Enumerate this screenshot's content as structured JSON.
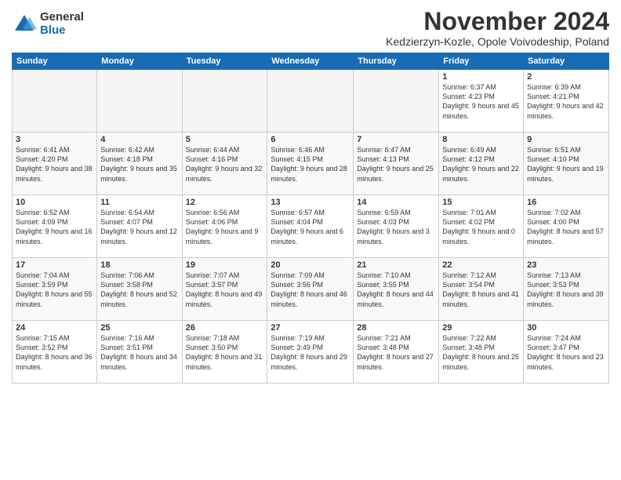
{
  "header": {
    "logo": {
      "general": "General",
      "blue": "Blue"
    },
    "title": "November 2024",
    "location": "Kedzierzyn-Kozle, Opole Voivodeship, Poland"
  },
  "weekdays": [
    "Sunday",
    "Monday",
    "Tuesday",
    "Wednesday",
    "Thursday",
    "Friday",
    "Saturday"
  ],
  "weeks": [
    [
      {
        "day": "",
        "empty": true
      },
      {
        "day": "",
        "empty": true
      },
      {
        "day": "",
        "empty": true
      },
      {
        "day": "",
        "empty": true
      },
      {
        "day": "",
        "empty": true
      },
      {
        "day": "1",
        "sunrise": "6:37 AM",
        "sunset": "4:23 PM",
        "daylight": "9 hours and 45 minutes."
      },
      {
        "day": "2",
        "sunrise": "6:39 AM",
        "sunset": "4:21 PM",
        "daylight": "9 hours and 42 minutes."
      }
    ],
    [
      {
        "day": "3",
        "sunrise": "6:41 AM",
        "sunset": "4:20 PM",
        "daylight": "9 hours and 38 minutes."
      },
      {
        "day": "4",
        "sunrise": "6:42 AM",
        "sunset": "4:18 PM",
        "daylight": "9 hours and 35 minutes."
      },
      {
        "day": "5",
        "sunrise": "6:44 AM",
        "sunset": "4:16 PM",
        "daylight": "9 hours and 32 minutes."
      },
      {
        "day": "6",
        "sunrise": "6:46 AM",
        "sunset": "4:15 PM",
        "daylight": "9 hours and 28 minutes."
      },
      {
        "day": "7",
        "sunrise": "6:47 AM",
        "sunset": "4:13 PM",
        "daylight": "9 hours and 25 minutes."
      },
      {
        "day": "8",
        "sunrise": "6:49 AM",
        "sunset": "4:12 PM",
        "daylight": "9 hours and 22 minutes."
      },
      {
        "day": "9",
        "sunrise": "6:51 AM",
        "sunset": "4:10 PM",
        "daylight": "9 hours and 19 minutes."
      }
    ],
    [
      {
        "day": "10",
        "sunrise": "6:52 AM",
        "sunset": "4:09 PM",
        "daylight": "9 hours and 16 minutes."
      },
      {
        "day": "11",
        "sunrise": "6:54 AM",
        "sunset": "4:07 PM",
        "daylight": "9 hours and 12 minutes."
      },
      {
        "day": "12",
        "sunrise": "6:56 AM",
        "sunset": "4:06 PM",
        "daylight": "9 hours and 9 minutes."
      },
      {
        "day": "13",
        "sunrise": "6:57 AM",
        "sunset": "4:04 PM",
        "daylight": "9 hours and 6 minutes."
      },
      {
        "day": "14",
        "sunrise": "6:59 AM",
        "sunset": "4:03 PM",
        "daylight": "9 hours and 3 minutes."
      },
      {
        "day": "15",
        "sunrise": "7:01 AM",
        "sunset": "4:02 PM",
        "daylight": "9 hours and 0 minutes."
      },
      {
        "day": "16",
        "sunrise": "7:02 AM",
        "sunset": "4:00 PM",
        "daylight": "8 hours and 57 minutes."
      }
    ],
    [
      {
        "day": "17",
        "sunrise": "7:04 AM",
        "sunset": "3:59 PM",
        "daylight": "8 hours and 55 minutes."
      },
      {
        "day": "18",
        "sunrise": "7:06 AM",
        "sunset": "3:58 PM",
        "daylight": "8 hours and 52 minutes."
      },
      {
        "day": "19",
        "sunrise": "7:07 AM",
        "sunset": "3:57 PM",
        "daylight": "8 hours and 49 minutes."
      },
      {
        "day": "20",
        "sunrise": "7:09 AM",
        "sunset": "3:56 PM",
        "daylight": "8 hours and 46 minutes."
      },
      {
        "day": "21",
        "sunrise": "7:10 AM",
        "sunset": "3:55 PM",
        "daylight": "8 hours and 44 minutes."
      },
      {
        "day": "22",
        "sunrise": "7:12 AM",
        "sunset": "3:54 PM",
        "daylight": "8 hours and 41 minutes."
      },
      {
        "day": "23",
        "sunrise": "7:13 AM",
        "sunset": "3:53 PM",
        "daylight": "8 hours and 39 minutes."
      }
    ],
    [
      {
        "day": "24",
        "sunrise": "7:15 AM",
        "sunset": "3:52 PM",
        "daylight": "8 hours and 36 minutes."
      },
      {
        "day": "25",
        "sunrise": "7:16 AM",
        "sunset": "3:51 PM",
        "daylight": "8 hours and 34 minutes."
      },
      {
        "day": "26",
        "sunrise": "7:18 AM",
        "sunset": "3:50 PM",
        "daylight": "8 hours and 31 minutes."
      },
      {
        "day": "27",
        "sunrise": "7:19 AM",
        "sunset": "3:49 PM",
        "daylight": "8 hours and 29 minutes."
      },
      {
        "day": "28",
        "sunrise": "7:21 AM",
        "sunset": "3:48 PM",
        "daylight": "8 hours and 27 minutes."
      },
      {
        "day": "29",
        "sunrise": "7:22 AM",
        "sunset": "3:48 PM",
        "daylight": "8 hours and 25 minutes."
      },
      {
        "day": "30",
        "sunrise": "7:24 AM",
        "sunset": "3:47 PM",
        "daylight": "8 hours and 23 minutes."
      }
    ]
  ]
}
